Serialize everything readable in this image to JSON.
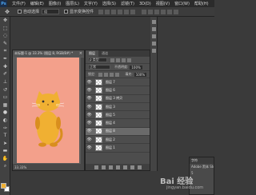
{
  "app": {
    "logo": "Ps"
  },
  "menu": {
    "items": [
      "文件(F)",
      "编辑(E)",
      "图像(I)",
      "图层(L)",
      "文字(Y)",
      "选择(S)",
      "滤镜(T)",
      "3D(D)",
      "视图(V)",
      "窗口(W)",
      "帮助(H)"
    ]
  },
  "options": {
    "auto_select_label": "自动选择",
    "auto_select_value": "组",
    "show_transform_label": "显示变换控件"
  },
  "document": {
    "tab_title": "未标题-1 @ 33.3% (图层 8, RGB/8#) *",
    "zoom_status": "33.33%",
    "canvas_color": "#f3a08b"
  },
  "layers_panel": {
    "tabs": [
      "图层",
      "通道"
    ],
    "kind_label": "ρ 类型",
    "blend_mode": "正常",
    "opacity_label": "不透明度:",
    "opacity_value": "100%",
    "lock_label": "锁定:",
    "fill_label": "填充:",
    "fill_value": "100%",
    "layers": [
      {
        "name": "图层 7",
        "selected": false
      },
      {
        "name": "图层 6",
        "selected": false
      },
      {
        "name": "图层 3 拷贝",
        "selected": false
      },
      {
        "name": "图层 3",
        "selected": false
      },
      {
        "name": "图层 5",
        "selected": false
      },
      {
        "name": "图层 4",
        "selected": false
      },
      {
        "name": "图层 8",
        "selected": true
      },
      {
        "name": "图层 2",
        "selected": false
      },
      {
        "name": "图层 1",
        "selected": false
      }
    ]
  },
  "character_panel": {
    "title": "字符",
    "font": "Adobe 黑体 Std",
    "size": "5"
  },
  "watermark": {
    "logo": "Bai 经验",
    "url": "jingyan.baidu.com"
  },
  "colors": {
    "foreground": "#f0b032",
    "background": "#ffffff",
    "cat_body": "#f0b032",
    "cat_dark": "#d98e1e"
  }
}
